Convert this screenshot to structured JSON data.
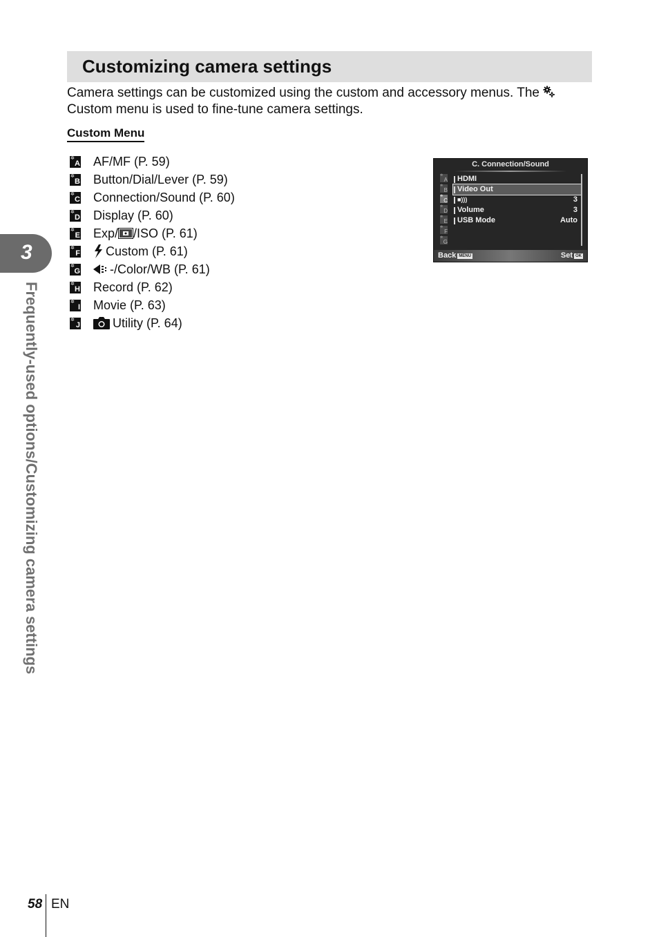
{
  "section": {
    "title": "Customizing camera settings",
    "intro_part1": "Camera settings can be customized using the custom and accessory menus. The",
    "intro_part2": "Custom menu is used to fine-tune camera settings.",
    "sub_heading": "Custom Menu"
  },
  "custom_menu": {
    "items": [
      {
        "letter": "A",
        "icon": "custom-tab-a-icon",
        "label": "AF/MF (P. 59)"
      },
      {
        "letter": "B",
        "icon": "custom-tab-b-icon",
        "label": "Button/Dial/Lever (P. 59)"
      },
      {
        "letter": "C",
        "icon": "custom-tab-c-icon",
        "label": "Connection/Sound (P. 60)"
      },
      {
        "letter": "D",
        "icon": "custom-tab-d-icon",
        "label": "Display (P. 60)"
      },
      {
        "letter": "E",
        "icon": "custom-tab-e-icon",
        "label_prefix": "Exp/",
        "inline_icon": "metering-icon",
        "label": "/ISO (P. 61)"
      },
      {
        "letter": "F",
        "icon": "custom-tab-f-icon",
        "inline_icon": "flash-icon",
        "label": "Custom (P. 61)"
      },
      {
        "letter": "G",
        "icon": "custom-tab-g-icon",
        "inline_icon": "image-quality-icon",
        "label": "-/Color/WB (P. 61)"
      },
      {
        "letter": "H",
        "icon": "custom-tab-h-icon",
        "label": "Record (P. 62)"
      },
      {
        "letter": "I",
        "icon": "custom-tab-i-icon",
        "label": "Movie (P. 63)"
      },
      {
        "letter": "J",
        "icon": "custom-tab-j-icon",
        "inline_icon": "camera-icon",
        "label": "Utility (P. 64)"
      }
    ]
  },
  "camera_screen": {
    "title": "C. Connection/Sound",
    "tabs": [
      "A",
      "B",
      "C",
      "D",
      "E",
      "F",
      "G"
    ],
    "active_tab": "C",
    "items": [
      {
        "label": "HDMI",
        "value": ""
      },
      {
        "label": "Video Out",
        "value": "",
        "selected": true
      },
      {
        "label": "■)))",
        "icon": "beep-icon",
        "value": "3"
      },
      {
        "label": "Volume",
        "value": "3"
      },
      {
        "label": "USB Mode",
        "value": "Auto"
      }
    ],
    "footer": {
      "back": "Back",
      "back_badge": "MENU",
      "set": "Set",
      "set_badge": "OK"
    }
  },
  "chapter": {
    "number": "3",
    "side_title": "Frequently-used options/Customizing camera settings"
  },
  "footer": {
    "page_number": "58",
    "language": "EN"
  }
}
